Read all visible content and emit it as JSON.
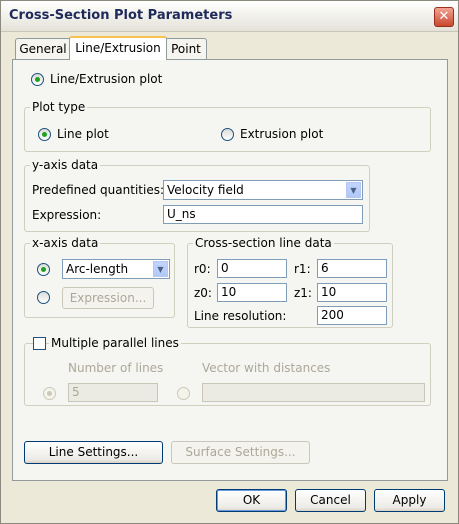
{
  "window": {
    "title": "Cross-Section Plot Parameters"
  },
  "tabs": [
    {
      "label": "General"
    },
    {
      "label": "Line/Extrusion"
    },
    {
      "label": "Point"
    }
  ],
  "line_extrusion_plot": {
    "label": "Line/Extrusion plot",
    "checked": true
  },
  "plot_type": {
    "legend": "Plot type",
    "line_plot": "Line plot",
    "extrusion_plot": "Extrusion plot",
    "selected": "Line plot"
  },
  "y_axis": {
    "legend": "y-axis data",
    "predefined_label": "Predefined quantities:",
    "predefined_value": "Velocity field",
    "expression_label": "Expression:",
    "expression_value": "U_ns"
  },
  "x_axis": {
    "legend": "x-axis data",
    "selected_value": "Arc-length",
    "expression_button": "Expression..."
  },
  "cross_section": {
    "legend": "Cross-section line data",
    "r0_label": "r0:",
    "r0_value": "0",
    "r1_label": "r1:",
    "r1_value": "6",
    "z0_label": "z0:",
    "z0_value": "10",
    "z1_label": "z1:",
    "z1_value": "10",
    "resolution_label": "Line resolution:",
    "resolution_value": "200"
  },
  "multiple_lines": {
    "label": "Multiple parallel lines",
    "checked": false,
    "number_label": "Number of lines",
    "number_value": "5",
    "vector_label": "Vector with distances",
    "vector_value": ""
  },
  "buttons": {
    "line_settings": "Line Settings...",
    "surface_settings": "Surface Settings...",
    "ok": "OK",
    "cancel": "Cancel",
    "apply": "Apply"
  },
  "icons": {
    "close": "close-icon",
    "dropdown": "chevron-down-icon"
  },
  "colors": {
    "radio_selected": "#21A121",
    "active_tab_accent": "#F7C250",
    "title_text": "#1E2A5A"
  }
}
